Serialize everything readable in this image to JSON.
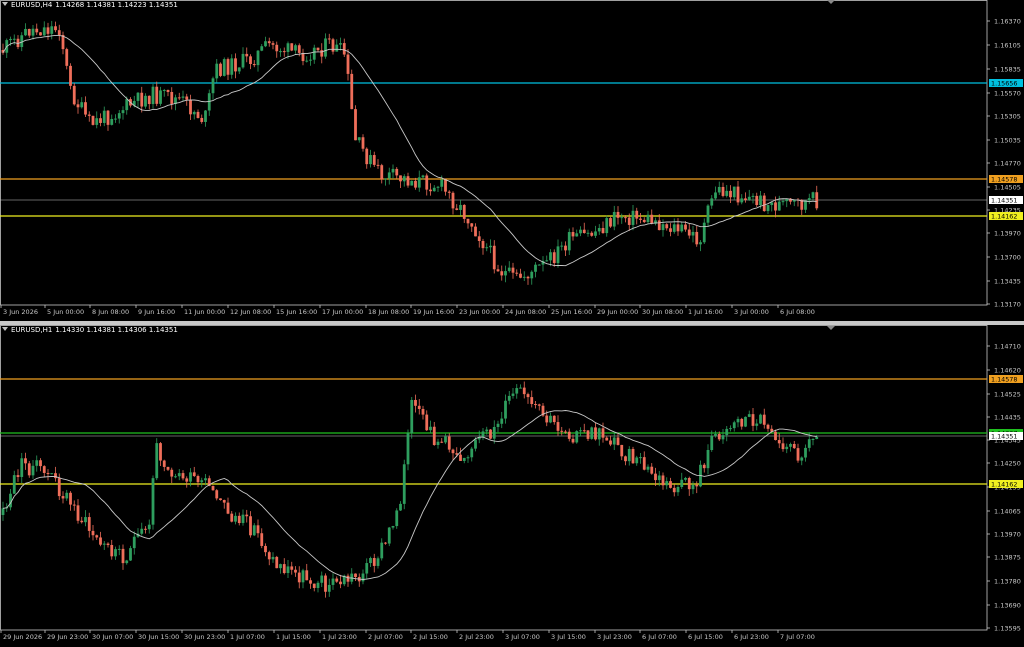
{
  "colors": {
    "bull": "#2e9e5e",
    "bear": "#ef6e5a",
    "ma": "#c8c8c8",
    "grid_border": "#c8c8c8",
    "cyan": "#00c0e0",
    "orange": "#f0a020",
    "yellow": "#f0f020",
    "green": "#20c020",
    "white_line": "#c8c8c8",
    "background": "#000000"
  },
  "top_pane": {
    "label": {
      "symbol": "EURUSD,H4",
      "quote": "1.14268 1.14381 1.14223 1.14351"
    },
    "y_axis_ticks": [
      "1.16370",
      "1.16105",
      "1.15835",
      "1.15570",
      "1.15305",
      "1.15035",
      "1.14770",
      "1.14505",
      "1.14235",
      "1.13970",
      "1.13700",
      "1.13435",
      "1.13170"
    ],
    "price_tags": [
      {
        "text": "1.15656",
        "color": "cyan"
      },
      {
        "text": "1.14578",
        "color": "orange"
      },
      {
        "text": "1.14351",
        "color": "white"
      },
      {
        "text": "1.14162",
        "color": "yellow"
      }
    ],
    "time_ticks": [
      "3 Jun 2026",
      "5 Jun 00:00",
      "8 Jun 08:00",
      "9 Jun 16:00",
      "11 Jun 00:00",
      "12 Jun 08:00",
      "15 Jun 16:00",
      "17 Jun 00:00",
      "18 Jun 08:00",
      "19 Jun 16:00",
      "23 Jun 00:00",
      "24 Jun 08:00",
      "25 Jun 16:00",
      "29 Jun 00:00",
      "30 Jun 08:00",
      "1 Jul 16:00",
      "3 Jul 00:00",
      "6 Jul 08:00"
    ]
  },
  "bottom_pane": {
    "label": {
      "symbol": "EURUSD,H1",
      "quote": "1.14330 1.14381 1.14306 1.14351"
    },
    "y_axis_ticks": [
      "1.14710",
      "1.14620",
      "1.14525",
      "1.14435",
      "1.14345",
      "1.14250",
      "1.14155",
      "1.14065",
      "1.13970",
      "1.13875",
      "1.13780",
      "1.13690",
      "1.13595"
    ],
    "price_tags": [
      {
        "text": "1.14578",
        "color": "orange"
      },
      {
        "text": "1.14367",
        "color": "green"
      },
      {
        "text": "1.14351",
        "color": "white"
      },
      {
        "text": "1.14162",
        "color": "yellow"
      }
    ],
    "time_ticks": [
      "29 Jun 2026",
      "29 Jun 23:00",
      "30 Jun 07:00",
      "30 Jun 15:00",
      "30 Jun 23:00",
      "1 Jul 07:00",
      "1 Jul 15:00",
      "1 Jul 23:00",
      "2 Jul 07:00",
      "2 Jul 15:00",
      "2 Jul 23:00",
      "3 Jul 07:00",
      "3 Jul 15:00",
      "3 Jul 23:00",
      "6 Jul 07:00",
      "6 Jul 15:00",
      "6 Jul 23:00",
      "7 Jul 07:00"
    ]
  }
}
